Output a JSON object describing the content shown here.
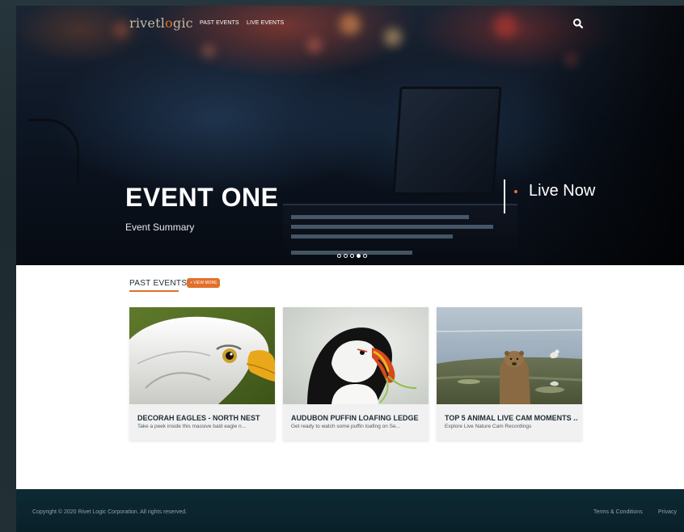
{
  "nav": {
    "logo_text_1": "rivetl",
    "logo_text_accent": "o",
    "logo_text_2": "gic",
    "links": [
      "PAST EVENTS",
      "LIVE EVENTS"
    ]
  },
  "hero": {
    "title": "EVENT ONE",
    "summary": "Event Summary",
    "live_label": "Live Now",
    "slides_total": 5,
    "active_slide": 4
  },
  "past_events": {
    "heading": "PAST EVENTS",
    "view_more": "+ VIEW MORE",
    "cards": [
      {
        "title": "DECORAH EAGLES - NORTH NEST",
        "description": "Take a peek inside this massive bald eagle n..."
      },
      {
        "title": "AUDUBON PUFFIN LOAFING LEDGE",
        "description": "Get ready to watch some puffin loafing on Se..."
      },
      {
        "title": "TOP 5 ANIMAL LIVE CAM MOMENTS ...",
        "description": "Explore Live Nature Cam Recordings"
      }
    ]
  },
  "footer": {
    "copyright": "Copyright © 2020 Rivet Logic Corporation. All rights reserved.",
    "links": [
      "Terms & Conditions",
      "Privacy"
    ]
  },
  "colors": {
    "accent": "#e2702b",
    "footer_bg": "#0d2a33",
    "text_dark": "#1d2b33"
  }
}
